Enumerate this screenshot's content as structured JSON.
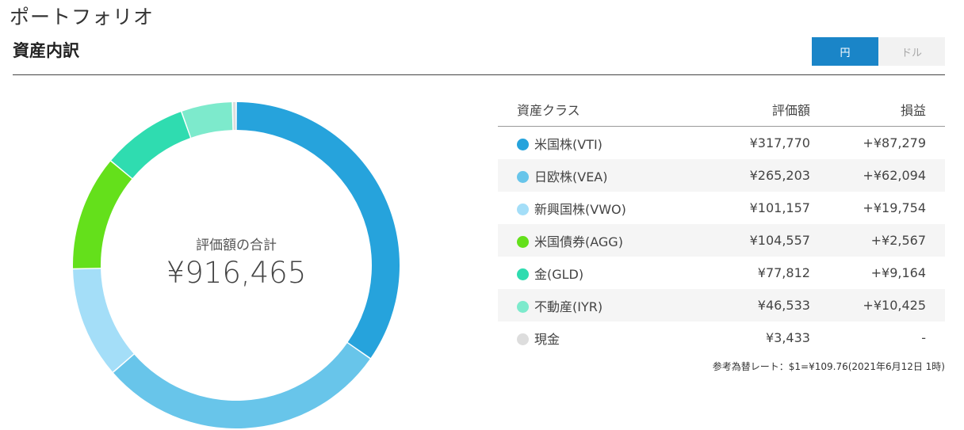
{
  "header": {
    "page_title": "ポートフォリオ",
    "section_title": "資産内訳",
    "currency_toggle": {
      "yen_label": "円",
      "dollar_label": "ドル",
      "selected": "円"
    }
  },
  "colors": {
    "accent": "#1a85c8",
    "positive": "#4dbd74"
  },
  "donut": {
    "total_label": "評価額の合計",
    "total_value": "¥916,465"
  },
  "table": {
    "headers": {
      "asset_class": "資産クラス",
      "valuation": "評価額",
      "profit_loss": "損益"
    },
    "rows": [
      {
        "name": "米国株(VTI)",
        "value": "¥317,770",
        "value_num": 317770,
        "pl": "+¥87,279",
        "color": "#26a3dc"
      },
      {
        "name": "日欧株(VEA)",
        "value": "¥265,203",
        "value_num": 265203,
        "pl": "+¥62,094",
        "color": "#68c5ea"
      },
      {
        "name": "新興国株(VWO)",
        "value": "¥101,157",
        "value_num": 101157,
        "pl": "+¥19,754",
        "color": "#a4def8"
      },
      {
        "name": "米国債券(AGG)",
        "value": "¥104,557",
        "value_num": 104557,
        "pl": "+¥2,567",
        "color": "#64e01b"
      },
      {
        "name": "金(GLD)",
        "value": "¥77,812",
        "value_num": 77812,
        "pl": "+¥9,164",
        "color": "#2fdcb0"
      },
      {
        "name": "不動産(IYR)",
        "value": "¥46,533",
        "value_num": 46533,
        "pl": "+¥10,425",
        "color": "#7deacc"
      },
      {
        "name": "現金",
        "value": "¥3,433",
        "value_num": 3433,
        "pl": "-",
        "color": "#dddddd"
      }
    ]
  },
  "fx_note": "参考為替レート：$1=¥109.76(2021年6月12日 1時)"
}
